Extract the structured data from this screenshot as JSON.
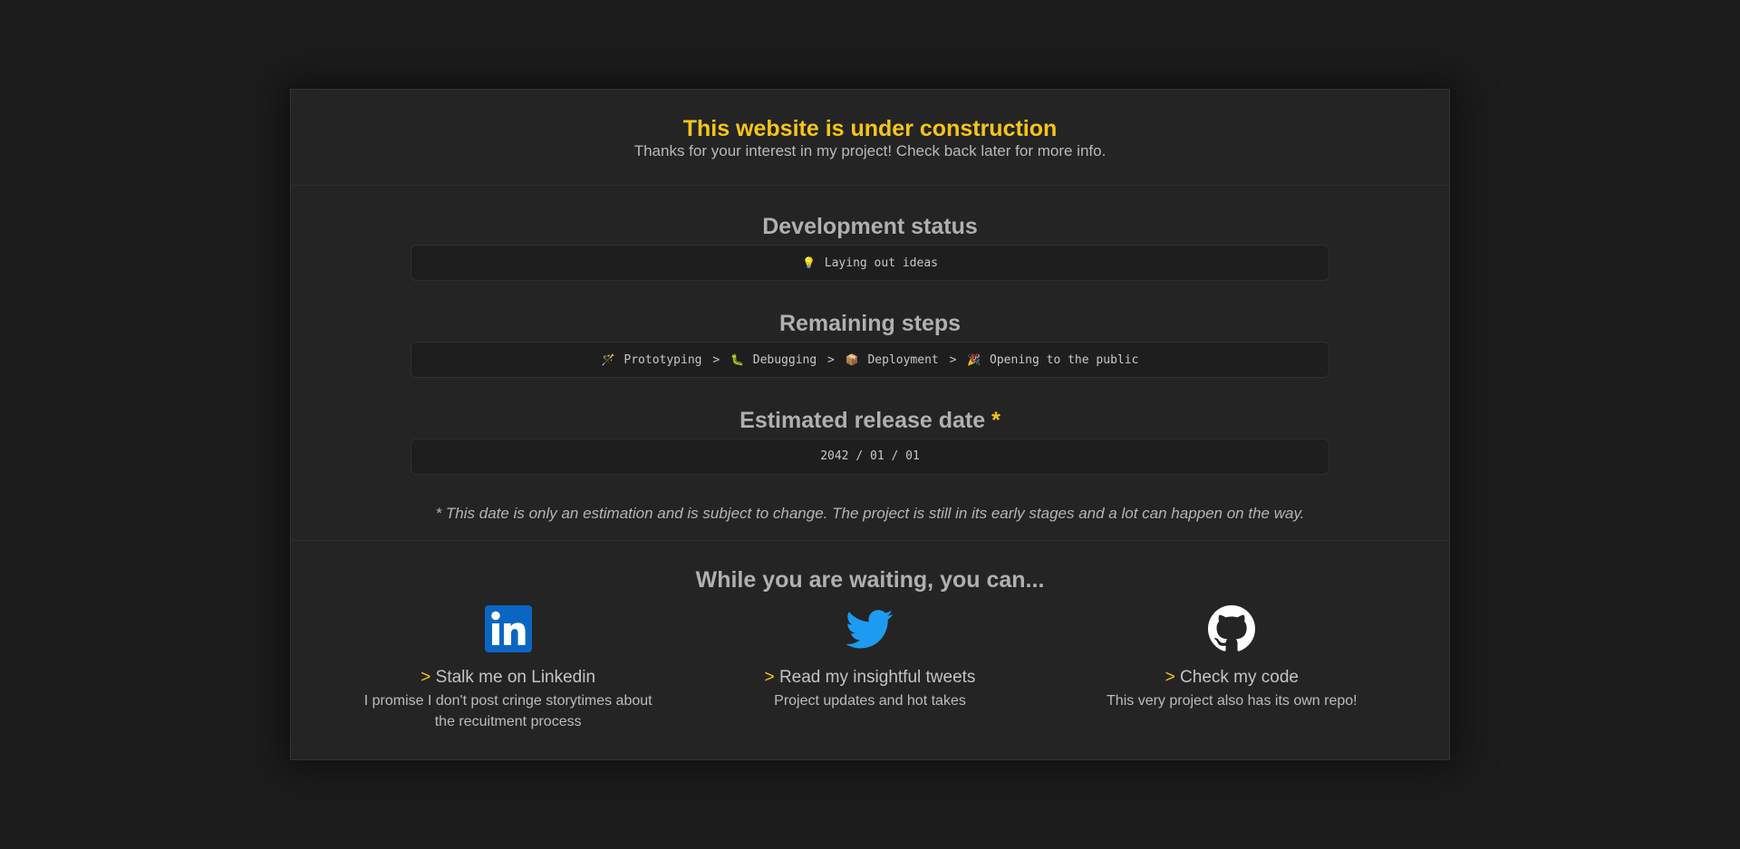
{
  "header": {
    "title": "This website is under construction",
    "subtitle": "Thanks for your interest in my project! Check back later for more info."
  },
  "status": {
    "heading": "Development status",
    "current_emoji": "💡",
    "current": "Laying out ideas"
  },
  "steps": {
    "heading": "Remaining steps",
    "separator": ">",
    "items": [
      {
        "emoji": "🪄",
        "label": "Prototyping"
      },
      {
        "emoji": "🐛",
        "label": "Debugging"
      },
      {
        "emoji": "📦",
        "label": "Deployment"
      },
      {
        "emoji": "🎉",
        "label": "Opening to the public"
      }
    ]
  },
  "release": {
    "heading": "Estimated release date",
    "asterisk": "*",
    "date": "2042 / 01 / 01",
    "note": "* This date is only an estimation and is subject to change. The project is still in its early stages and a lot can happen on the way."
  },
  "links": {
    "heading": "While you are waiting, you can...",
    "arrow": ">",
    "items": [
      {
        "icon": "linkedin-icon",
        "title": "Stalk me on Linkedin",
        "desc": "I promise I don't post cringe storytimes about the recuitment process"
      },
      {
        "icon": "twitter-icon",
        "title": "Read my insightful tweets",
        "desc": "Project updates and hot takes"
      },
      {
        "icon": "github-icon",
        "title": "Check my code",
        "desc": "This very project also has its own repo!"
      }
    ]
  },
  "colors": {
    "accent": "#f5c518",
    "background": "#1c1c1c",
    "card": "#242424",
    "linkedin": "#0a66c2",
    "twitter": "#1d9bf0"
  }
}
